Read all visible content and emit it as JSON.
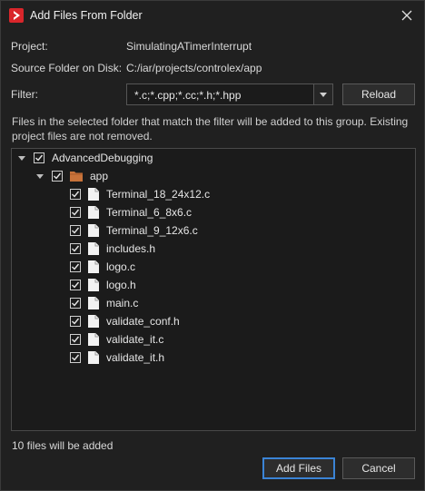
{
  "window": {
    "title": "Add Files From Folder",
    "icon": "iar-logo-icon",
    "close_icon": "close-icon"
  },
  "info": {
    "project_label": "Project:",
    "project_value": "SimulatingATimerInterrupt",
    "source_label": "Source Folder on Disk:",
    "source_value": "C:/iar/projects/controlex/app"
  },
  "filter": {
    "label": "Filter:",
    "value": "*.c;*.cpp;*.cc;*.h;*.hpp",
    "reload_label": "Reload"
  },
  "description": "Files in the selected folder that match the filter will be added to this group. Existing project files are not removed.",
  "tree": {
    "root": {
      "label": "AdvancedDebugging",
      "checked": true,
      "expanded": true
    },
    "folder": {
      "label": "app",
      "checked": true,
      "expanded": true
    },
    "files": [
      {
        "label": "Terminal_18_24x12.c",
        "checked": true
      },
      {
        "label": "Terminal_6_8x6.c",
        "checked": true
      },
      {
        "label": "Terminal_9_12x6.c",
        "checked": true
      },
      {
        "label": "includes.h",
        "checked": true
      },
      {
        "label": "logo.c",
        "checked": true
      },
      {
        "label": "logo.h",
        "checked": true
      },
      {
        "label": "main.c",
        "checked": true
      },
      {
        "label": "validate_conf.h",
        "checked": true
      },
      {
        "label": "validate_it.c",
        "checked": true
      },
      {
        "label": "validate_it.h",
        "checked": true
      }
    ]
  },
  "status": "10 files will be added",
  "buttons": {
    "add_files": "Add Files",
    "cancel": "Cancel"
  },
  "colors": {
    "background": "#202020",
    "accent": "#3b84d6",
    "brand": "#d9262b",
    "folder": "#c8733a"
  }
}
